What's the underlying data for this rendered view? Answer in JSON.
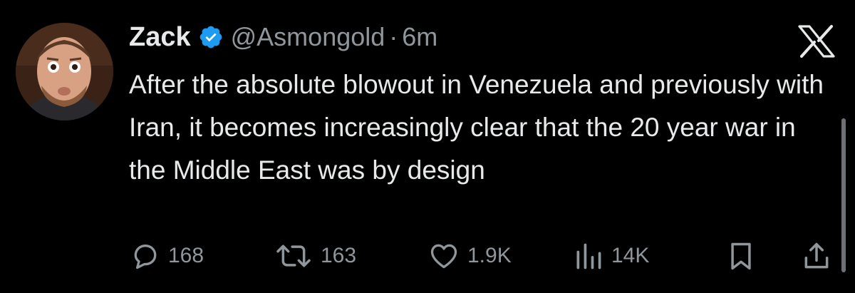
{
  "tweet": {
    "display_name": "Zack",
    "handle": "@Asmongold",
    "separator": "·",
    "time": "6m",
    "verified": true,
    "text": "After the absolute blowout in Venezuela and previously with Iran, it becomes increasingly clear that the 20 year war in the Middle East was by design"
  },
  "metrics": {
    "replies": "168",
    "reposts": "163",
    "likes": "1.9K",
    "views": "14K"
  },
  "icons": {
    "reply": "reply-icon",
    "repost": "repost-icon",
    "like": "heart-icon",
    "views": "views-icon",
    "bookmark": "bookmark-icon",
    "share": "share-icon",
    "close": "x-logo-icon",
    "verified": "verified-badge-icon"
  },
  "colors": {
    "background": "#000000",
    "text": "#e7e9ea",
    "secondary": "#8f969c",
    "verified": "#1d9bf0"
  }
}
